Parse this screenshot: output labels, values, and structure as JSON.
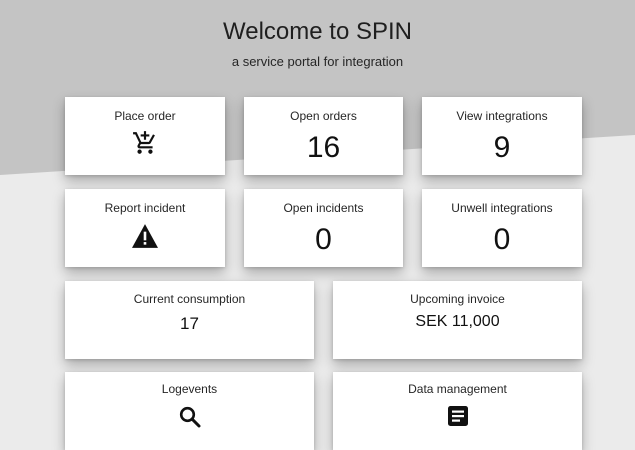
{
  "header": {
    "title": "Welcome to SPIN",
    "subtitle": "a service portal for integration"
  },
  "colors": {
    "header_bg": "#c4c4c4",
    "page_bg": "#ebebeb",
    "card_bg": "#ffffff"
  },
  "tiles": {
    "place_order": {
      "label": "Place order",
      "icon": "cart-plus-icon"
    },
    "open_orders": {
      "label": "Open orders",
      "value": "16"
    },
    "view_integrations": {
      "label": "View integrations",
      "value": "9"
    },
    "report_incident": {
      "label": "Report incident",
      "icon": "warning-icon"
    },
    "open_incidents": {
      "label": "Open incidents",
      "value": "0"
    },
    "unwell_integrations": {
      "label": "Unwell integrations",
      "value": "0"
    },
    "current_consumption": {
      "label": "Current consumption",
      "value": "17"
    },
    "upcoming_invoice": {
      "label": "Upcoming invoice",
      "value": "SEK 11,000"
    },
    "logevents": {
      "label": "Logevents",
      "icon": "search-icon"
    },
    "data_management": {
      "label": "Data management",
      "icon": "document-icon"
    }
  }
}
